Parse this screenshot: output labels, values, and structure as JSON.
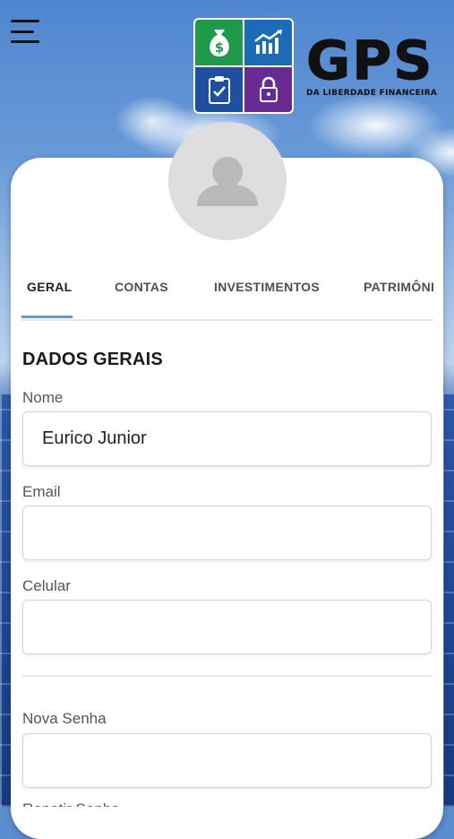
{
  "header": {
    "menu_icon": "hamburger-menu-icon",
    "logo": {
      "word": "GPS",
      "subtitle": "DA LIBERDADE FINANCEIRA",
      "tiles": [
        {
          "icon": "money-bag-icon",
          "color": "#1e9a4a"
        },
        {
          "icon": "chart-up-icon",
          "color": "#1b6bb8"
        },
        {
          "icon": "clipboard-check-icon",
          "color": "#1e4fa0"
        },
        {
          "icon": "padlock-icon",
          "color": "#6a2a93"
        }
      ]
    }
  },
  "profile": {
    "avatar_icon": "user-silhouette-icon"
  },
  "tabs": [
    {
      "label": "GERAL",
      "active": true
    },
    {
      "label": "CONTAS",
      "active": false
    },
    {
      "label": "INVESTIMENTOS",
      "active": false
    },
    {
      "label": "PATRIMÔNI",
      "active": false
    }
  ],
  "form": {
    "section_title": "DADOS GERAIS",
    "fields": [
      {
        "label": "Nome",
        "value": "Eurico Junior"
      },
      {
        "label": "Email",
        "value": ""
      },
      {
        "label": "Celular",
        "value": ""
      },
      {
        "label": "Nova Senha",
        "value": ""
      }
    ],
    "next_label_partial": "Repetir Senha"
  },
  "colors": {
    "tab_indicator": "#6b9ac6",
    "card_background": "#ffffff",
    "avatar_background": "#dedede"
  }
}
